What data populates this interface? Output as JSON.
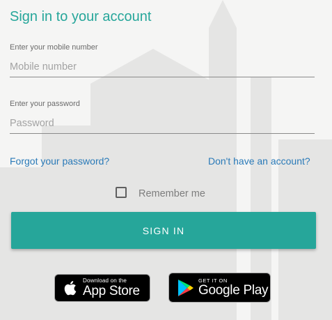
{
  "header": {
    "title": "Sign in to your account"
  },
  "form": {
    "mobile": {
      "label": "Enter your mobile number",
      "placeholder": "Mobile number",
      "value": ""
    },
    "password": {
      "label": "Enter your password",
      "placeholder": "Password",
      "value": ""
    },
    "forgot_link": "Forgot your password?",
    "signup_link": "Don't have an account?",
    "remember_label": "Remember me",
    "remember_checked": false,
    "signin_label": "SIGN IN"
  },
  "stores": {
    "appstore": {
      "small": "Download on the",
      "big": "App Store",
      "icon": "apple-icon"
    },
    "googleplay": {
      "small": "GET IT ON",
      "big": "Google Play",
      "icon": "google-play-icon"
    }
  },
  "colors": {
    "accent": "#26a69a",
    "link": "#2a7ab8",
    "background": "#f5f5f4"
  }
}
